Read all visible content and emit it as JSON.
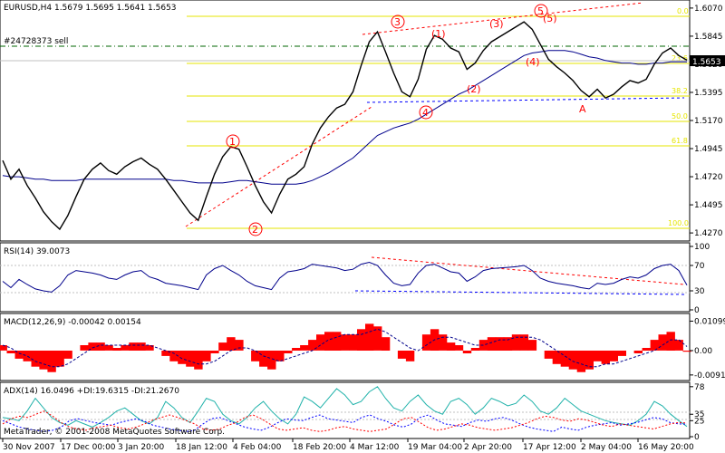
{
  "chart_data": [
    {
      "type": "line",
      "title": "EURUSD,H4  1.5679 1.5695 1.5641 1.5653",
      "order_label": "#24728373 sell",
      "current_price_label": "1.5653",
      "y_ticks": [
        "1.6070",
        "1.5845",
        "1.5620",
        "1.5395",
        "1.5170",
        "1.4945",
        "1.4720",
        "1.4495",
        "1.4270"
      ],
      "ylim": [
        1.422,
        1.612
      ],
      "fib_levels": [
        "0.0",
        "23.6",
        "38.2",
        "50.0",
        "61.8",
        "100.0"
      ],
      "wave_labels": [
        "1",
        "2",
        "3",
        "4",
        "1",
        "2",
        "3",
        "4",
        "5",
        "5",
        "A"
      ],
      "close": [
        1.485,
        1.47,
        1.478,
        1.465,
        1.455,
        1.444,
        1.436,
        1.43,
        1.441,
        1.456,
        1.47,
        1.478,
        1.483,
        1.477,
        1.474,
        1.48,
        1.484,
        1.487,
        1.482,
        1.478,
        1.47,
        1.461,
        1.452,
        1.443,
        1.437,
        1.456,
        1.474,
        1.488,
        1.496,
        1.494,
        1.48,
        1.465,
        1.452,
        1.443,
        1.458,
        1.47,
        1.474,
        1.48,
        1.498,
        1.511,
        1.52,
        1.527,
        1.53,
        1.54,
        1.561,
        1.58,
        1.588,
        1.572,
        1.555,
        1.54,
        1.536,
        1.55,
        1.574,
        1.585,
        1.582,
        1.575,
        1.572,
        1.558,
        1.563,
        1.573,
        1.58,
        1.584,
        1.588,
        1.592,
        1.596,
        1.59,
        1.578,
        1.566,
        1.56,
        1.555,
        1.549,
        1.541,
        1.536,
        1.542,
        1.535,
        1.538,
        1.544,
        1.549,
        1.547,
        1.55,
        1.562,
        1.571,
        1.575,
        1.569,
        1.5653
      ],
      "ma": [
        1.473,
        1.472,
        1.472,
        1.471,
        1.47,
        1.47,
        1.469,
        1.469,
        1.469,
        1.469,
        1.47,
        1.47,
        1.47,
        1.47,
        1.47,
        1.47,
        1.47,
        1.47,
        1.47,
        1.47,
        1.47,
        1.469,
        1.469,
        1.468,
        1.467,
        1.467,
        1.467,
        1.467,
        1.468,
        1.469,
        1.469,
        1.468,
        1.467,
        1.466,
        1.466,
        1.466,
        1.466,
        1.467,
        1.469,
        1.472,
        1.475,
        1.479,
        1.483,
        1.487,
        1.493,
        1.499,
        1.505,
        1.508,
        1.511,
        1.513,
        1.515,
        1.518,
        1.522,
        1.526,
        1.53,
        1.534,
        1.538,
        1.541,
        1.545,
        1.549,
        1.553,
        1.557,
        1.561,
        1.565,
        1.569,
        1.571,
        1.572,
        1.573,
        1.573,
        1.573,
        1.572,
        1.57,
        1.568,
        1.567,
        1.565,
        1.564,
        1.563,
        1.563,
        1.562,
        1.562,
        1.563,
        1.563,
        1.564,
        1.564,
        1.564
      ]
    },
    {
      "type": "line",
      "title": "RSI(14) 39.0073",
      "y_ticks": [
        "100",
        "70",
        "30",
        "0"
      ],
      "ylim": [
        0,
        100
      ],
      "values": [
        45,
        35,
        48,
        40,
        33,
        30,
        28,
        38,
        55,
        62,
        60,
        58,
        55,
        50,
        48,
        55,
        60,
        62,
        52,
        48,
        42,
        40,
        38,
        35,
        32,
        55,
        65,
        70,
        62,
        55,
        45,
        38,
        35,
        32,
        50,
        60,
        62,
        65,
        72,
        70,
        68,
        66,
        62,
        64,
        72,
        75,
        70,
        55,
        42,
        38,
        40,
        58,
        70,
        72,
        66,
        60,
        58,
        45,
        52,
        62,
        65,
        66,
        67,
        68,
        70,
        62,
        50,
        45,
        42,
        40,
        38,
        35,
        33,
        42,
        40,
        42,
        48,
        52,
        50,
        55,
        65,
        70,
        72,
        62,
        39
      ]
    },
    {
      "type": "area",
      "title": "MACD(12,26,9) -0.00042 0.00154",
      "y_ticks": [
        "0.01099",
        "0.00",
        "-0.0091"
      ],
      "ylim": [
        -0.0105,
        0.0125
      ],
      "values": [
        0.002,
        -0.001,
        -0.003,
        -0.004,
        -0.006,
        -0.007,
        -0.008,
        -0.006,
        -0.003,
        0.0,
        0.002,
        0.003,
        0.003,
        0.002,
        0.001,
        0.002,
        0.003,
        0.003,
        0.002,
        0.0,
        -0.002,
        -0.004,
        -0.005,
        -0.006,
        -0.007,
        -0.004,
        -0.001,
        0.003,
        0.005,
        0.004,
        0.0,
        -0.004,
        -0.006,
        -0.007,
        -0.004,
        -0.001,
        0.001,
        0.002,
        0.004,
        0.006,
        0.007,
        0.007,
        0.006,
        0.006,
        0.008,
        0.01,
        0.009,
        0.005,
        0.0,
        -0.003,
        -0.004,
        0.0,
        0.006,
        0.008,
        0.006,
        0.003,
        0.002,
        -0.001,
        0.001,
        0.004,
        0.005,
        0.005,
        0.005,
        0.006,
        0.006,
        0.004,
        0.0,
        -0.003,
        -0.005,
        -0.006,
        -0.007,
        -0.008,
        -0.007,
        -0.004,
        -0.005,
        -0.004,
        -0.002,
        0.0,
        -0.001,
        0.001,
        0.004,
        0.006,
        0.007,
        0.004,
        -0.0004
      ],
      "signal": [
        0.002,
        0.001,
        -0.001,
        -0.002,
        -0.004,
        -0.005,
        -0.006,
        -0.006,
        -0.005,
        -0.003,
        -0.001,
        0.001,
        0.002,
        0.002,
        0.002,
        0.002,
        0.002,
        0.002,
        0.002,
        0.001,
        0.0,
        -0.001,
        -0.003,
        -0.004,
        -0.005,
        -0.005,
        -0.004,
        -0.002,
        0.0,
        0.001,
        0.001,
        0.0,
        -0.002,
        -0.003,
        -0.004,
        -0.003,
        -0.002,
        -0.001,
        0.0,
        0.002,
        0.004,
        0.005,
        0.006,
        0.006,
        0.006,
        0.007,
        0.008,
        0.007,
        0.005,
        0.003,
        0.001,
        0.0,
        0.002,
        0.004,
        0.005,
        0.005,
        0.004,
        0.003,
        0.002,
        0.002,
        0.003,
        0.004,
        0.004,
        0.005,
        0.005,
        0.005,
        0.004,
        0.002,
        0.0,
        -0.002,
        -0.004,
        -0.005,
        -0.006,
        -0.006,
        -0.005,
        -0.005,
        -0.004,
        -0.003,
        -0.002,
        -0.001,
        0.0,
        0.002,
        0.004,
        0.004,
        0.0015
      ]
    },
    {
      "type": "line",
      "title": "ADX(14) 16.0496 +DI:19.6315 -DI:21.2670",
      "y_ticks": [
        "78",
        "35",
        "25",
        "0"
      ],
      "ylim": [
        0,
        82
      ],
      "series": [
        {
          "values": [
            30,
            28,
            25,
            40,
            60,
            45,
            30,
            22,
            18,
            25,
            20,
            15,
            22,
            30,
            40,
            45,
            35,
            25,
            20,
            30,
            55,
            45,
            30,
            22,
            40,
            60,
            55,
            35,
            25,
            20,
            30,
            45,
            55,
            40,
            28,
            20,
            35,
            62,
            55,
            45,
            60,
            75,
            65,
            50,
            55,
            70,
            78,
            60,
            45,
            40,
            55,
            65,
            50,
            40,
            35,
            55,
            60,
            50,
            35,
            45,
            60,
            55,
            48,
            52,
            65,
            55,
            40,
            35,
            45,
            60,
            50,
            40,
            35,
            30,
            25,
            22,
            20,
            18,
            25,
            35,
            55,
            48,
            35,
            25,
            16
          ]
        },
        {
          "values": [
            25,
            20,
            15,
            12,
            10,
            8,
            10,
            15,
            25,
            28,
            25,
            22,
            20,
            18,
            22,
            25,
            28,
            24,
            18,
            15,
            12,
            10,
            8,
            10,
            20,
            28,
            30,
            25,
            20,
            15,
            12,
            10,
            15,
            22,
            28,
            26,
            25,
            30,
            34,
            28,
            26,
            24,
            22,
            30,
            34,
            28,
            24,
            18,
            15,
            20,
            30,
            34,
            26,
            20,
            18,
            16,
            22,
            26,
            24,
            28,
            30,
            26,
            20,
            15,
            12,
            10,
            8,
            15,
            12,
            10,
            15,
            18,
            20,
            22,
            18,
            20,
            22,
            26,
            30,
            28,
            22,
            20,
            19.6
          ]
        },
        {
          "values": [
            20,
            28,
            32,
            30,
            35,
            40,
            32,
            22,
            15,
            12,
            10,
            14,
            16,
            18,
            14,
            12,
            15,
            20,
            26,
            30,
            34,
            30,
            25,
            20,
            12,
            10,
            12,
            18,
            22,
            30,
            34,
            28,
            20,
            12,
            10,
            12,
            14,
            10,
            8,
            10,
            14,
            16,
            12,
            10,
            8,
            10,
            12,
            20,
            28,
            30,
            22,
            14,
            10,
            12,
            16,
            20,
            18,
            14,
            12,
            10,
            12,
            14,
            18,
            22,
            28,
            32,
            30,
            26,
            24,
            28,
            26,
            22,
            18,
            16,
            20,
            18,
            16,
            14,
            12,
            16,
            20,
            22,
            21.3
          ]
        }
      ],
      "levels": [
        35,
        25
      ]
    }
  ],
  "x_ticks": [
    "30 Nov 2007",
    "17 Dec 00:00",
    "3 Jan 20:00",
    "18 Jan 12:00",
    "4 Feb 04:00",
    "18 Feb 20:00",
    "4 Mar 12:00",
    "19 Mar 04:00",
    "2 Apr 20:00",
    "17 Apr 12:00",
    "2 May 04:00",
    "16 May 20:00"
  ],
  "copyright": "MetaTrader, © 2001-2008 MetaQuotes Software Corp.",
  "colors": {
    "price": "#000000",
    "ma": "#00008b",
    "fib": "#e6e600",
    "wave": "#ff0000",
    "macd": "#ff0000",
    "rsi": "#00008b",
    "adx_plus": "#0000ff",
    "adx_minus": "#ff0000",
    "adx_main": "#20b2aa"
  }
}
